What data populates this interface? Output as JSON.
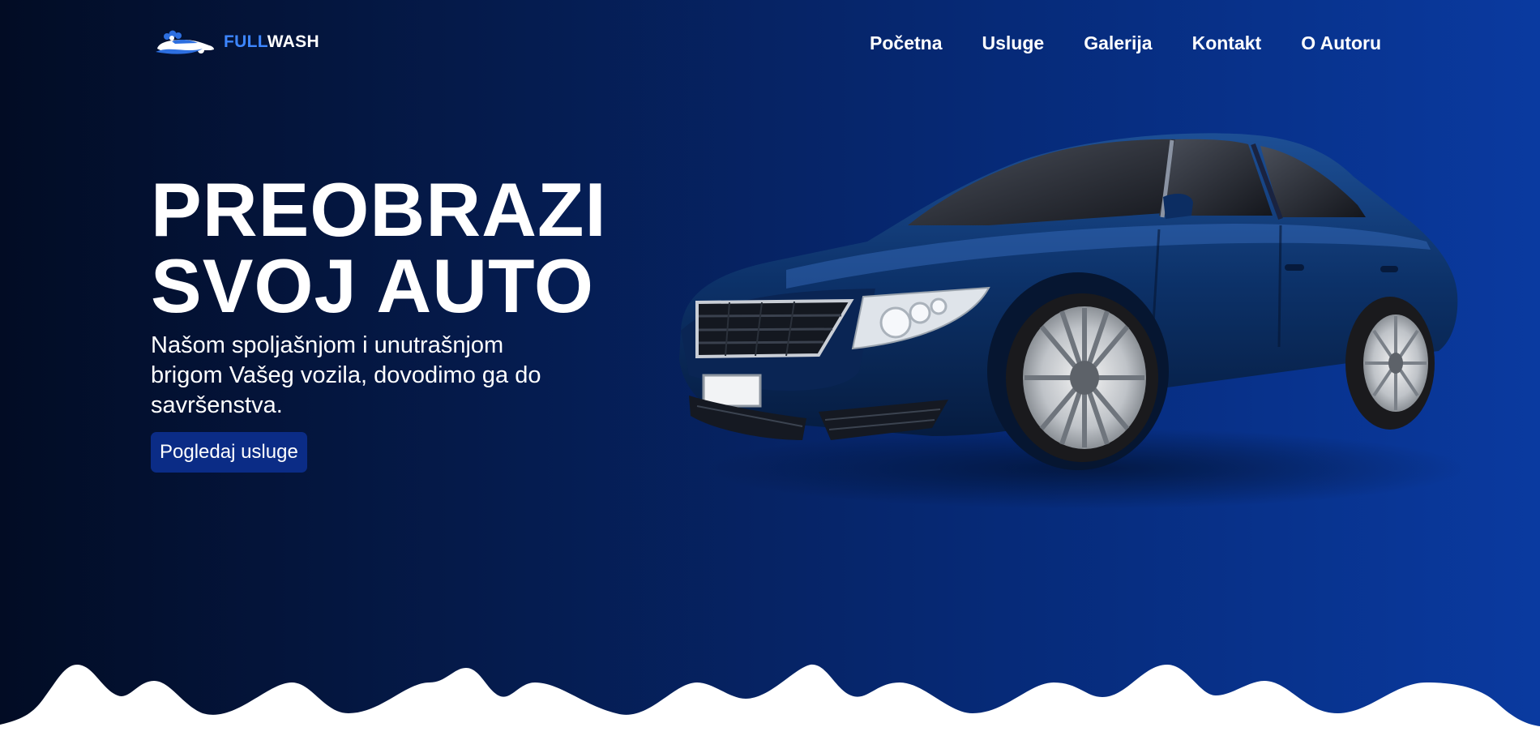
{
  "header": {
    "logo": {
      "full": "FULL",
      "wash": "WASH"
    },
    "nav": [
      {
        "label": "Početna"
      },
      {
        "label": "Usluge"
      },
      {
        "label": "Galerija"
      },
      {
        "label": "Kontakt"
      },
      {
        "label": "O Autoru"
      }
    ]
  },
  "hero": {
    "title_line1": "PREOBRAZI",
    "title_line2": "SVOJ AUTO",
    "subtitle": "Našom spoljašnjom i unutrašnjom brigom Vašeg vozila, dovodimo ga do savršenstva.",
    "cta_label": "Pogledaj usluge"
  },
  "icons": {
    "logo": "car-wash-logo-icon",
    "hero_image": "blue-sedan-car"
  },
  "colors": {
    "background_dark": "#020c24",
    "background_light": "#0a3aa0",
    "accent": "#3d86ff",
    "button": "#0b2c86",
    "text": "#ffffff"
  }
}
